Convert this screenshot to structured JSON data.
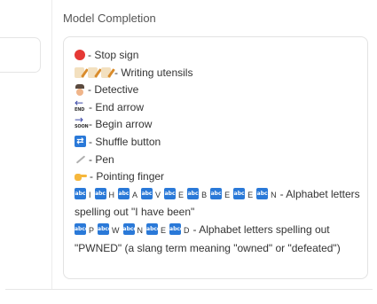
{
  "panel": {
    "title": "Model Completion"
  },
  "completion": {
    "items": [
      {
        "icon": "red-circle-icon",
        "text": "- Stop sign"
      },
      {
        "icon": "writing-icon",
        "text": "- Writing utensils"
      },
      {
        "icon": "detective-icon",
        "text": "- Detective"
      },
      {
        "icon": "end-arrow-icon",
        "arrow_word": "END",
        "text": "- End arrow"
      },
      {
        "icon": "soon-arrow-icon",
        "arrow_word": "SOON",
        "text": "- Begin arrow"
      },
      {
        "icon": "shuffle-icon",
        "text": "- Shuffle button"
      },
      {
        "icon": "pen-icon",
        "text": "- Pen"
      },
      {
        "icon": "pointing-finger-icon",
        "text": "- Pointing finger"
      }
    ],
    "alphabet_line": {
      "tile_text": "abc",
      "letters": [
        "I",
        "H",
        "A",
        "V",
        "E",
        "B",
        "E",
        "E",
        "N"
      ],
      "text": "- Alphabet letters spelling out \"I have been\""
    },
    "pwned_line": {
      "tile_text": "abcd",
      "letters": [
        "P",
        "W",
        "N",
        "E",
        "D"
      ],
      "text": "- Alphabet letters spelling out \"PWNED\" (a slang term meaning \"owned\" or \"defeated\")"
    }
  },
  "colors": {
    "stop_red": "#e53935",
    "tile_blue": "#2a79d8",
    "arrow_blue": "#3d4aa8",
    "finger_yellow": "#f6b73c"
  }
}
